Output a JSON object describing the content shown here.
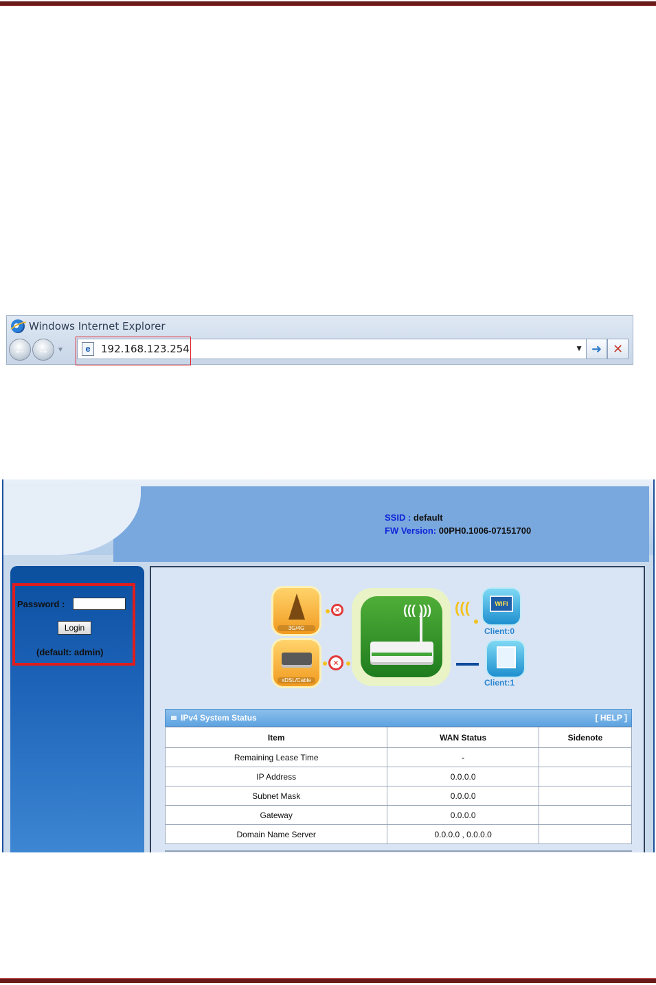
{
  "browser": {
    "title": "Windows Internet Explorer",
    "address": "192.168.123.254",
    "go_icon": "arrow-right-icon",
    "stop_icon": "close-icon"
  },
  "router_ui": {
    "ssid_label": "SSID :",
    "ssid_value": "default",
    "fw_label": "FW Version:",
    "fw_value": "00PH0.1006-07151700",
    "login": {
      "password_label": "Password :",
      "password_value": "",
      "button": "Login",
      "hint": "(default: admin)"
    },
    "diagram": {
      "wan_3g": "3G/4G",
      "wan_dsl": "xDSL/Cable",
      "client_wifi": "Client:0",
      "client_lan": "Client:1",
      "wifi_tile": "WIFI"
    },
    "status_panel": {
      "title": "IPv4 System Status",
      "help": "[ HELP ]",
      "headers": [
        "Item",
        "WAN Status",
        "Sidenote"
      ],
      "rows": [
        [
          "Remaining Lease Time",
          "-",
          ""
        ],
        [
          "IP Address",
          "0.0.0.0",
          ""
        ],
        [
          "Subnet Mask",
          "0.0.0.0",
          ""
        ],
        [
          "Gateway",
          "0.0.0.0",
          ""
        ],
        [
          "Domain Name Server",
          "0.0.0.0 , 0.0.0.0",
          ""
        ]
      ]
    }
  },
  "colors": {
    "rule": "#6b1a1a",
    "highlight": "#e01d1d",
    "label_blue": "#1025d8",
    "sidebar": "#0b4f9f"
  }
}
